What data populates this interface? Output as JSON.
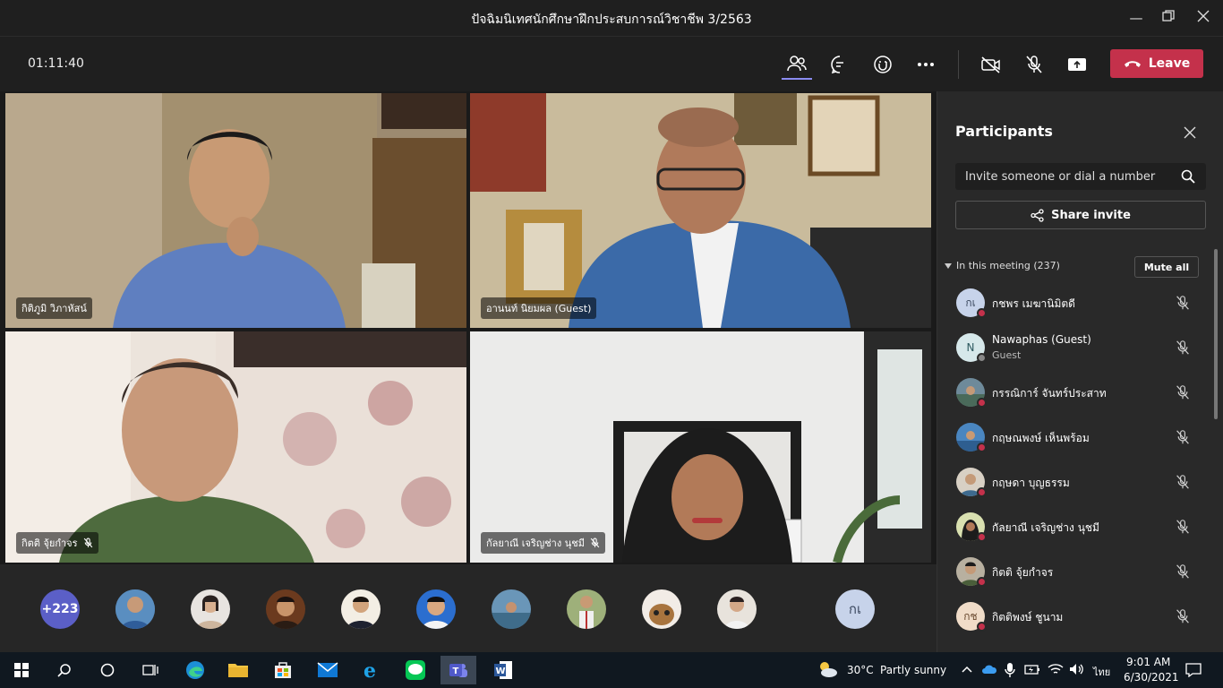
{
  "window": {
    "title": "ปัจฉิมนิเทศนักศึกษาฝึกประสบการณ์วิชาชีพ 3/2563"
  },
  "toolbar": {
    "timer": "01:11:40",
    "leave_label": "Leave"
  },
  "tiles": [
    {
      "name": "กิติภูมิ วิภาหัสน์",
      "muted": false
    },
    {
      "name": "อานนท์ นิยมผล (Guest)",
      "muted": false
    },
    {
      "name": "กิตติ จุ้ยกำจร",
      "muted": true
    },
    {
      "name": "กัลยาณี เจริญช่าง นุชมี",
      "muted": true
    }
  ],
  "avatar_strip": {
    "more_count": "+223",
    "initials": "กเ"
  },
  "panel": {
    "title": "Participants",
    "invite_placeholder": "Invite someone or dial a number",
    "share_label": "Share invite",
    "in_meeting_label": "In this meeting (237)",
    "mute_all_label": "Mute all",
    "participants": [
      {
        "name": "กชพร เมฆานิมิตดี",
        "initials": "กเ",
        "sub": ""
      },
      {
        "name": "Nawaphas (Guest)",
        "initials": "N",
        "sub": "Guest"
      },
      {
        "name": "กรรณิการ์ จันทร์ประสาท",
        "initials": "",
        "sub": ""
      },
      {
        "name": "กฤษณพงษ์ เห็นพร้อม",
        "initials": "",
        "sub": ""
      },
      {
        "name": "กฤษดา บุญธรรม",
        "initials": "",
        "sub": ""
      },
      {
        "name": "กัลยาณี เจริญช่าง นุชมี",
        "initials": "",
        "sub": ""
      },
      {
        "name": "กิตติ จุ้ยกำจร",
        "initials": "",
        "sub": ""
      },
      {
        "name": "กิตติพงษ์ ชูนาม",
        "initials": "กช",
        "sub": ""
      }
    ]
  },
  "taskbar": {
    "weather_temp": "30°C",
    "weather_desc": "Partly sunny",
    "lang": "ไทย",
    "time": "9:01 AM",
    "date": "6/30/2021"
  }
}
